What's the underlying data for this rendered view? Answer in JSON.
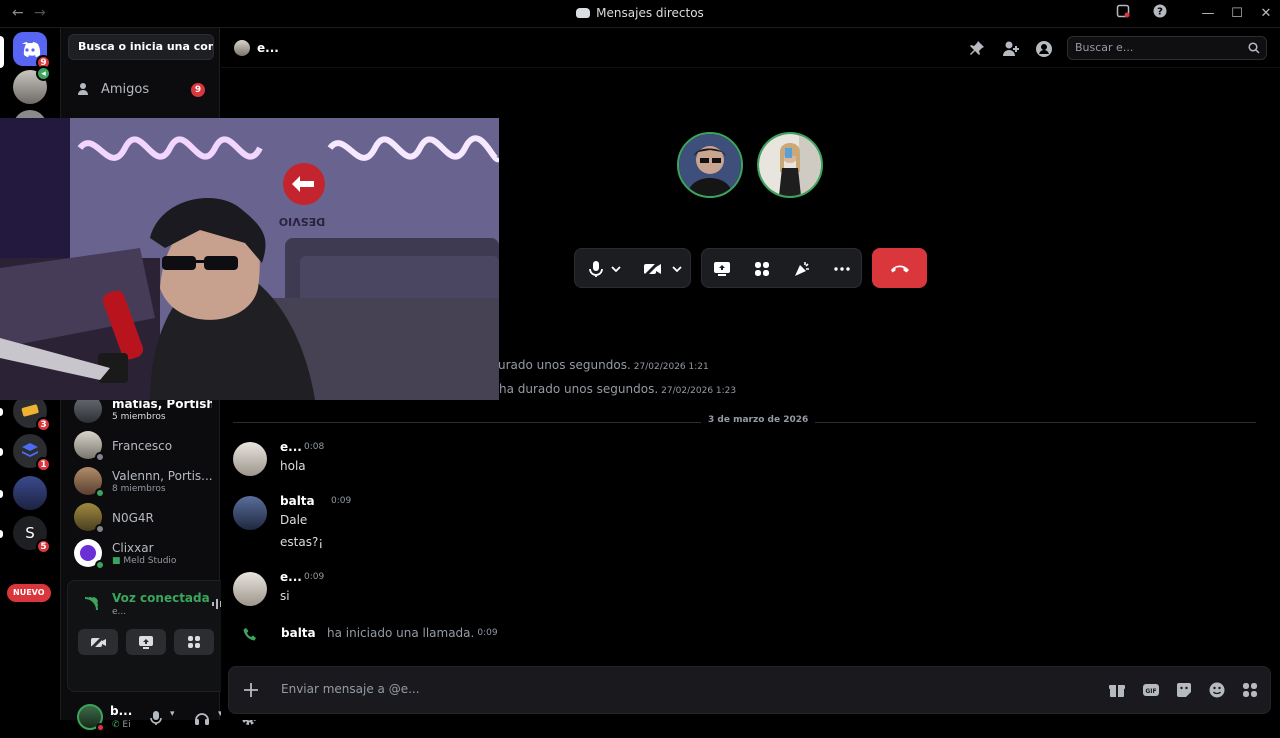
{
  "window": {
    "title": "Mensajes directos"
  },
  "dm_search": {
    "label": "Busca o inicia una conv..."
  },
  "friends": {
    "label": "Amigos",
    "badge": "9"
  },
  "servers": {
    "home_badge": "9",
    "badges": [
      "3",
      "1",
      "5"
    ],
    "s_letter": "S",
    "new_label": "NUEVO"
  },
  "dms": [
    {
      "name": "matias, Portish...",
      "sub": "5 miembros"
    },
    {
      "name": "Francesco",
      "sub": ""
    },
    {
      "name": "Valennn, Portis...",
      "sub": "8 miembros"
    },
    {
      "name": "N0G4R",
      "sub": ""
    },
    {
      "name": "Clixxar",
      "sub": "Meld Studio"
    }
  ],
  "voice": {
    "status": "Voz conectada",
    "channel": "e..."
  },
  "user": {
    "name": "b...",
    "status": "Ei"
  },
  "channel": {
    "name": "e...",
    "search_placeholder": "Buscar e..."
  },
  "call_log": [
    {
      "text": "urado unos segundos.",
      "time": "27/02/2026 1:21"
    },
    {
      "text": "ha durado unos segundos.",
      "time": "27/02/2026 1:23"
    }
  ],
  "date_divider": "3 de marzo de 2026",
  "messages": [
    {
      "author": "e...",
      "time": "0:08",
      "lines": [
        "hola"
      ]
    },
    {
      "author": "balta",
      "time": "0:09",
      "lines": [
        "Dale",
        "estas?¡"
      ]
    },
    {
      "author": "e...",
      "time": "0:09",
      "lines": [
        "si"
      ]
    }
  ],
  "call_started": {
    "author": "balta",
    "text": "ha iniciado una llamada.",
    "time": "0:09"
  },
  "composer": {
    "placeholder": "Enviar mensaje a @e..."
  },
  "colors": {
    "accent": "#5865f2",
    "danger": "#da373c",
    "online": "#3ba55d"
  }
}
